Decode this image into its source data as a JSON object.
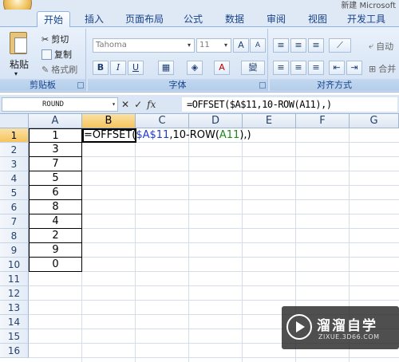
{
  "window": {
    "title": "新建 Microsoft"
  },
  "tabs": [
    "开始",
    "插入",
    "页面布局",
    "公式",
    "数据",
    "审阅",
    "视图",
    "开发工具"
  ],
  "ribbon": {
    "clipboard": {
      "paste": "粘贴",
      "cut": "剪切",
      "copy": "复制",
      "format_painter": "格式刷",
      "label": "剪贴板"
    },
    "font": {
      "name": "Tahoma",
      "size": "11",
      "label": "字体",
      "bold": "B",
      "italic": "I",
      "underline": "U",
      "grow": "A",
      "shrink": "A",
      "phonetic": "變"
    },
    "alignment": {
      "label": "对齐方式",
      "wrap": "自动",
      "merge": "合并"
    }
  },
  "formula_bar": {
    "name_box": "ROUND",
    "formula": "=OFFSET($A$11,10-ROW(A11),)"
  },
  "grid": {
    "columns": [
      "A",
      "B",
      "C",
      "D",
      "E",
      "F",
      "G"
    ],
    "rows": [
      "1",
      "2",
      "3",
      "4",
      "5",
      "6",
      "7",
      "8",
      "9",
      "10",
      "11",
      "12",
      "13",
      "14",
      "15",
      "16"
    ],
    "column_a_values": [
      "1",
      "3",
      "7",
      "5",
      "6",
      "8",
      "4",
      "2",
      "9",
      "0"
    ],
    "active_cell": "B1",
    "edit_parts": [
      "=OFFSET(",
      "$A$11",
      ",10-ROW(",
      "A11",
      "),)"
    ]
  },
  "watermark": {
    "name": "溜溜自学",
    "url": "ZIXUE.3D66.COM"
  },
  "colors": {
    "accent": "#15428b",
    "selected_header": "#f5c45e",
    "ref_blue": "#1f3bd4",
    "ref_green": "#1a8a1a"
  }
}
